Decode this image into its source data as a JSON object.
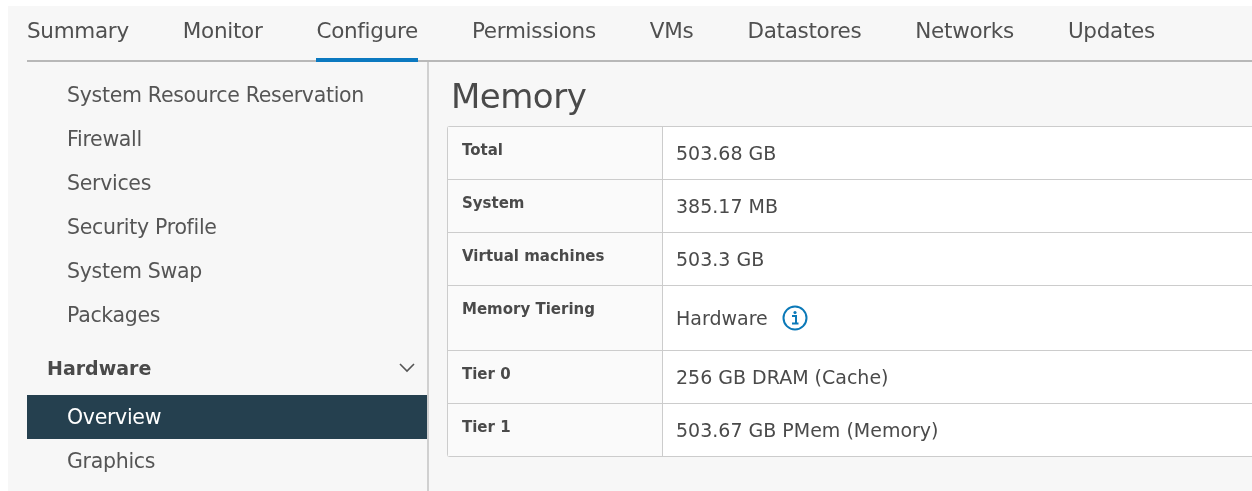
{
  "tabs": [
    {
      "label": "Summary",
      "selected": false
    },
    {
      "label": "Monitor",
      "selected": false
    },
    {
      "label": "Configure",
      "selected": true
    },
    {
      "label": "Permissions",
      "selected": false
    },
    {
      "label": "VMs",
      "selected": false
    },
    {
      "label": "Datastores",
      "selected": false
    },
    {
      "label": "Networks",
      "selected": false
    },
    {
      "label": "Updates",
      "selected": false
    }
  ],
  "sidebar": {
    "items": [
      {
        "kind": "item",
        "label": "System Resource Reservation",
        "selected": false
      },
      {
        "kind": "item",
        "label": "Firewall",
        "selected": false
      },
      {
        "kind": "item",
        "label": "Services",
        "selected": false
      },
      {
        "kind": "item",
        "label": "Security Profile",
        "selected": false
      },
      {
        "kind": "item",
        "label": "System Swap",
        "selected": false
      },
      {
        "kind": "item",
        "label": "Packages",
        "selected": false
      },
      {
        "kind": "group",
        "label": "Hardware",
        "expanded": true,
        "children": [
          {
            "label": "Overview",
            "selected": true
          },
          {
            "label": "Graphics",
            "selected": false
          }
        ]
      }
    ]
  },
  "content": {
    "title": "Memory",
    "rows": [
      {
        "label": "Total",
        "value": "503.68 GB",
        "info": false
      },
      {
        "label": "System",
        "value": "385.17 MB",
        "info": false
      },
      {
        "label": "Virtual machines",
        "value": "503.3 GB",
        "info": false
      },
      {
        "label": "Memory Tiering",
        "value": "Hardware",
        "info": true
      },
      {
        "label": "Tier 0",
        "value": "256 GB DRAM (Cache)",
        "info": false
      },
      {
        "label": "Tier 1",
        "value": "503.67 GB PMem (Memory)",
        "info": false
      }
    ]
  }
}
